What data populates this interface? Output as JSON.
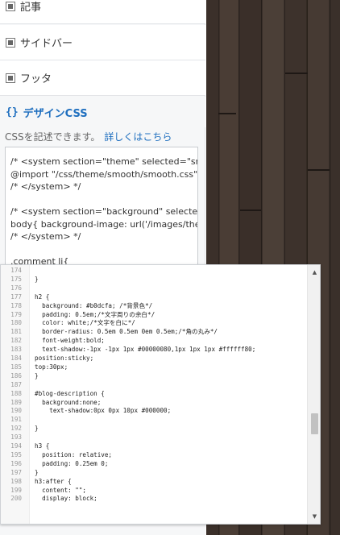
{
  "sections": [
    {
      "label": "記事"
    },
    {
      "label": "サイドバー"
    },
    {
      "label": "フッタ"
    }
  ],
  "design_css": {
    "icon": "{}",
    "title": "デザインCSS",
    "description": "CSSを記述できます。",
    "link": "詳しくはこちら"
  },
  "css_box_lines": [
    "/* <system section=\"theme\" selected=\"smooth",
    "@import \"/css/theme/smooth/smooth.css\";",
    "/* </system> */",
    "",
    "/* <system section=\"background\" selected=\"pa",
    "body{ background-image: url('/images/theme/l",
    "/* </system> */",
    "",
    ".comment li{"
  ],
  "editor_lines": [
    {
      "n": "174",
      "t": ""
    },
    {
      "n": "175",
      "t": "}"
    },
    {
      "n": "176",
      "t": ""
    },
    {
      "n": "177",
      "t": "h2 {"
    },
    {
      "n": "178",
      "t": "  background: #b0dcfa; /*背景色*/"
    },
    {
      "n": "179",
      "t": "  padding: 0.5em;/*文字周りの余白*/"
    },
    {
      "n": "180",
      "t": "  color: white;/*文字を白に*/"
    },
    {
      "n": "181",
      "t": "  border-radius: 0.5em 0.5em 0em 0.5em;/*角の丸み*/"
    },
    {
      "n": "182",
      "t": "  font-weight:bold;"
    },
    {
      "n": "183",
      "t": "  text-shadow:-1px -1px 1px #00000080,1px 1px 1px #ffffff80;"
    },
    {
      "n": "184",
      "t": "position:sticky;"
    },
    {
      "n": "185",
      "t": "top:30px;"
    },
    {
      "n": "186",
      "t": "}"
    },
    {
      "n": "187",
      "t": ""
    },
    {
      "n": "188",
      "t": "#blog-description {"
    },
    {
      "n": "189",
      "t": "  background:none;"
    },
    {
      "n": "190",
      "t": "    text-shadow:0px 0px 10px #000000;"
    },
    {
      "n": "191",
      "t": ""
    },
    {
      "n": "192",
      "t": "}"
    },
    {
      "n": "193",
      "t": ""
    },
    {
      "n": "194",
      "t": "h3 {"
    },
    {
      "n": "195",
      "t": "  position: relative;"
    },
    {
      "n": "196",
      "t": "  padding: 0.25em 0;"
    },
    {
      "n": "197",
      "t": "}"
    },
    {
      "n": "198",
      "t": "h3:after {"
    },
    {
      "n": "199",
      "t": "  content: \"\";"
    },
    {
      "n": "200",
      "t": "  display: block;"
    }
  ],
  "scrollbar": {
    "up_icon": "▲",
    "down_icon": "▼"
  }
}
